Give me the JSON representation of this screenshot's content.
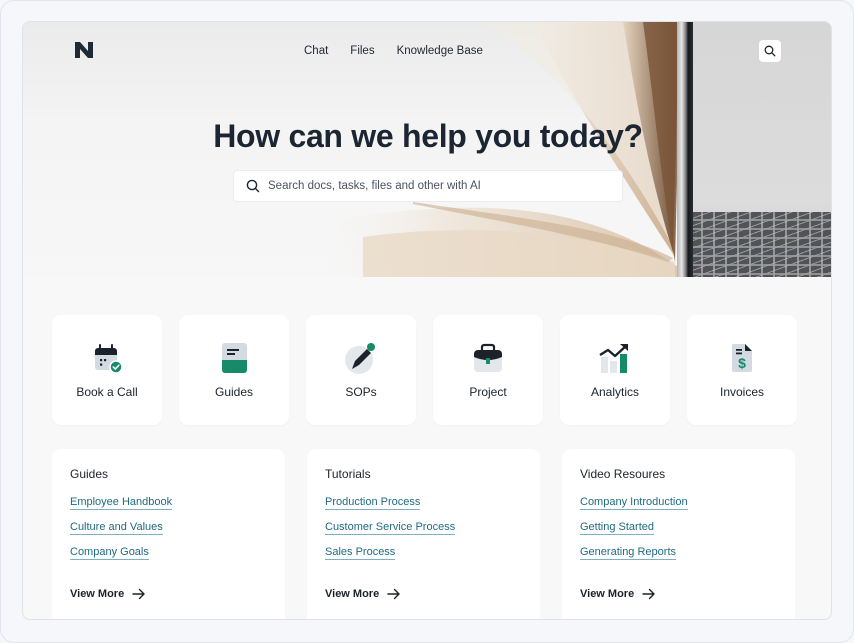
{
  "nav": {
    "logo": "N",
    "links": [
      "Chat",
      "Files",
      "Knowledge Base"
    ],
    "search_icon": "search-icon"
  },
  "hero": {
    "title": "How can we help you today?",
    "search_placeholder": "Search docs, tasks, files and other with AI",
    "search_value": ""
  },
  "tiles": [
    {
      "label": "Book a Call",
      "icon": "calendar-check-icon"
    },
    {
      "label": "Guides",
      "icon": "book-icon"
    },
    {
      "label": "SOPs",
      "icon": "pen-icon"
    },
    {
      "label": "Project",
      "icon": "briefcase-icon"
    },
    {
      "label": "Analytics",
      "icon": "chart-trend-icon"
    },
    {
      "label": "Invoices",
      "icon": "invoice-dollar-icon"
    }
  ],
  "cards": [
    {
      "title": "Guides",
      "links": [
        "Employee Handbook",
        "Culture and Values",
        "Company Goals"
      ],
      "view_more": "View More"
    },
    {
      "title": "Tutorials",
      "links": [
        "Production Process",
        "Customer Service Process",
        "Sales Process"
      ],
      "view_more": "View More"
    },
    {
      "title": "Video Resoures",
      "links": [
        "Company Introduction",
        "Getting Started",
        "Generating Reports"
      ],
      "view_more": "View More"
    }
  ],
  "colors": {
    "accent_green": "#178a68",
    "link_teal": "#1f6b80",
    "dark": "#1c2532",
    "icon_gray": "#d3dae2"
  }
}
